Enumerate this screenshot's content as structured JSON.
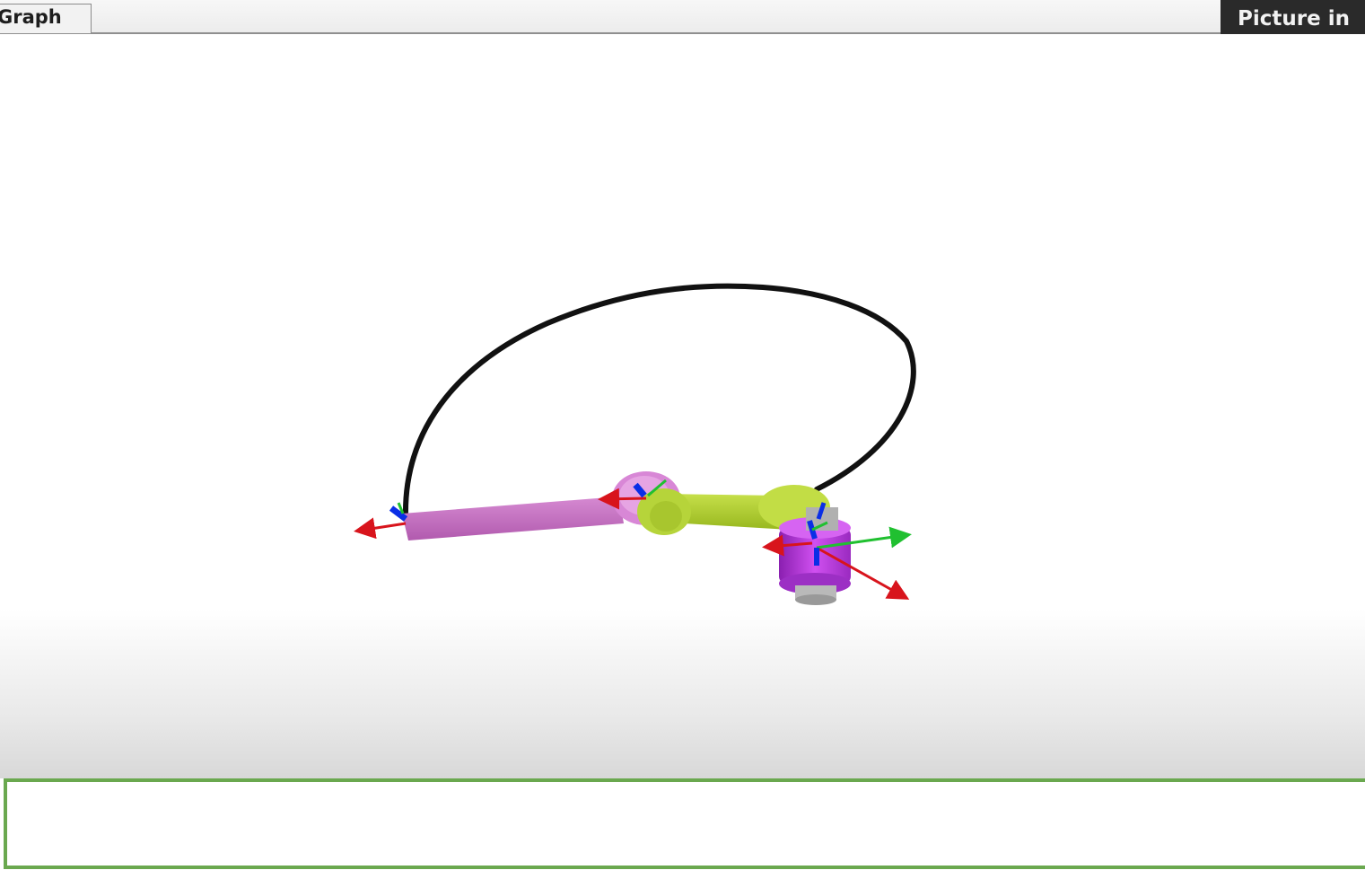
{
  "tabs": {
    "graph_label": "Graph"
  },
  "overlay": {
    "pip_label": "Picture in"
  },
  "colors": {
    "trajectory": "#111111",
    "link_1": "#c46fc0",
    "link_2": "#b5d633",
    "base": "#c040e0",
    "axis_x": "#d8141c",
    "axis_y": "#20c030",
    "axis_z": "#0a2ee6",
    "panel_border": "#6aa84f"
  }
}
